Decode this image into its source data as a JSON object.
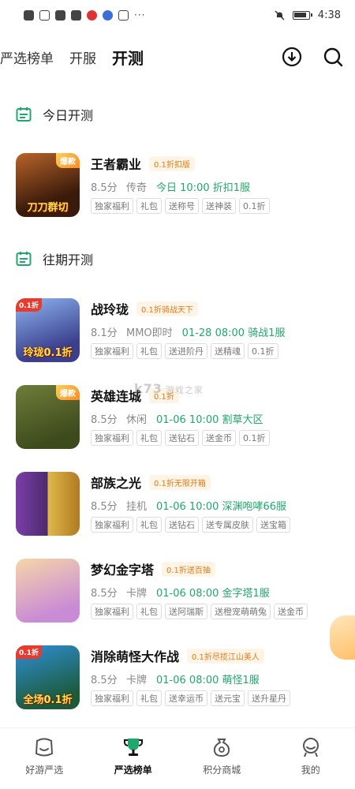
{
  "status_bar": {
    "time": "4:38",
    "dots": "···"
  },
  "top_nav": {
    "tabs": [
      {
        "label": "严选榜单",
        "active": false
      },
      {
        "label": "开服",
        "active": false
      },
      {
        "label": "开测",
        "active": true
      }
    ],
    "icons": [
      "download-icon",
      "search-icon"
    ]
  },
  "sections": {
    "today": {
      "title": "今日开测"
    },
    "past": {
      "title": "往期开测"
    }
  },
  "games": [
    {
      "name": "王者霸业",
      "promo": "0.1折扣版",
      "score": "8.5分",
      "genre": "传奇",
      "time": "今日 10:00 折扣1服",
      "tags": [
        "独家福利",
        "礼包",
        "送称号",
        "送神装",
        "0.1折"
      ],
      "badge": "爆款",
      "art_text": "刀刀群切"
    },
    {
      "name": "战玲珑",
      "promo": "0.1折骑战天下",
      "score": "8.1分",
      "genre": "MMO即时",
      "time": "01-28 08:00 骑战1服",
      "tags": [
        "独家福利",
        "礼包",
        "送进阶丹",
        "送精魂",
        "0.1折"
      ],
      "corner": "0.1折",
      "art_text": "玲珑0.1折"
    },
    {
      "name": "英雄连城",
      "promo": "0.1折",
      "score": "8.5分",
      "genre": "休闲",
      "time": "01-06 10:00 割草大区",
      "tags": [
        "独家福利",
        "礼包",
        "送钻石",
        "送金币",
        "0.1折"
      ],
      "badge": "爆款"
    },
    {
      "name": "部族之光",
      "promo": "0.1折无限开箱",
      "score": "8.5分",
      "genre": "挂机",
      "time": "01-06 10:00 深渊咆哮66服",
      "tags": [
        "独家福利",
        "礼包",
        "送钻石",
        "送专属皮肤",
        "送宝箱"
      ]
    },
    {
      "name": "梦幻金字塔",
      "promo": "0.1折送百抽",
      "score": "8.5分",
      "genre": "卡牌",
      "time": "01-06 08:00 金字塔1服",
      "tags": [
        "独家福利",
        "礼包",
        "送阿瑞斯",
        "送橙宠萌萌兔",
        "送金币"
      ]
    },
    {
      "name": "消除萌怪大作战",
      "promo": "0.1折尽揽江山美人",
      "score": "8.5分",
      "genre": "卡牌",
      "time": "01-06 08:00 萌怪1服",
      "tags": [
        "独家福利",
        "礼包",
        "送幸运币",
        "送元宝",
        "送升星丹"
      ],
      "corner": "0.1折",
      "art_text": "全场0.1折"
    }
  ],
  "watermark": {
    "text": "k73",
    "sub": "游戏之家"
  },
  "bottom_nav": [
    {
      "label": "好游严选",
      "icon": "smile-bag-icon",
      "active": false
    },
    {
      "label": "严选榜单",
      "icon": "trophy-icon",
      "active": true
    },
    {
      "label": "积分商城",
      "icon": "coin-bag-icon",
      "active": false
    },
    {
      "label": "我的",
      "icon": "profile-icon",
      "active": false
    }
  ],
  "colors": {
    "accent": "#1fa86b",
    "promo": "#e07b1a",
    "promo_bg": "#fff4e6"
  }
}
